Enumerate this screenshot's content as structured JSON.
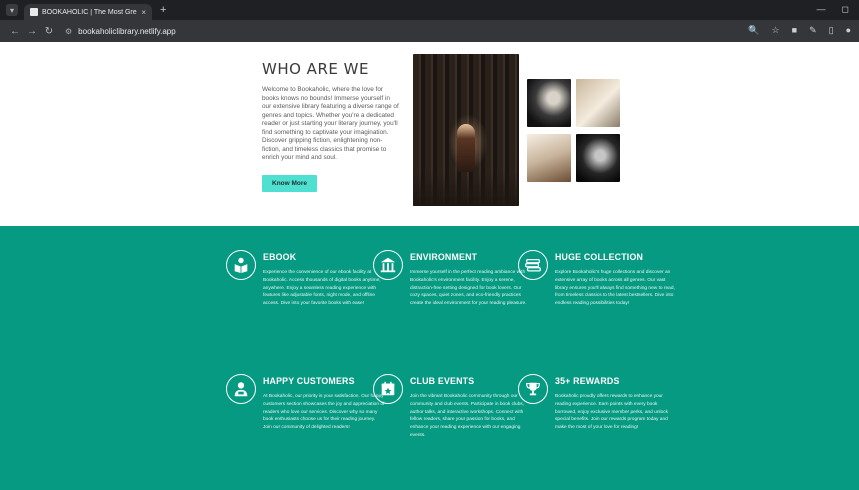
{
  "browser": {
    "tab_title": "BOOKAHOLIC | The Most Grea",
    "tab_close": "×",
    "new_tab": "+",
    "url": "bookaholiclibrary.netlify.app"
  },
  "about": {
    "title": "WHO ARE WE",
    "body": "Welcome to Bookaholic, where the love for books knows no bounds! Immerse yourself in our extensive library featuring a diverse range of genres and topics. Whether you're a dedicated reader or just starting your literary journey, you'll find something to captivate your imagination. Discover gripping fiction, enlightening non-fiction, and timeless classics that promise to enrich your mind and soul.",
    "button": "Know More"
  },
  "features": [
    {
      "title": "EBOOK",
      "icon": "reader-icon",
      "body": "Experience the convenience of our ebook facility at Bookaholic. Access thousands of digital books anytime, anywhere. Enjoy a seamless reading experience with features like adjustable fonts, night mode, and offline access. Dive into your favorite books with ease!"
    },
    {
      "title": "ENVIRONMENT",
      "icon": "building-icon",
      "body": "Immerse yourself in the perfect reading ambiance with Bookaholic's environment facility. Enjoy a serene, distraction-free setting designed for book lovers. Our cozy spaces, quiet zones, and eco-friendly practices create the ideal environment for your reading pleasure."
    },
    {
      "title": "HUGE COLLECTION",
      "icon": "book-stack-icon",
      "body": "Explore Bookaholic's huge collections and discover an extensive array of books across all genres. Our vast library ensures you'll always find something new to read, from timeless classics to the latest bestsellers. Dive into endless reading possibilities today!"
    },
    {
      "title": "HAPPY CUSTOMERS",
      "icon": "customer-icon",
      "body": "At Bookaholic, our priority is your satisfaction. Our happy customers section showcases the joy and appreciation of readers who love our services. Discover why so many book enthusiasts choose us for their reading journey. Join our community of delighted readers!"
    },
    {
      "title": "CLUB EVENTS",
      "icon": "calendar-star-icon",
      "body": "Join the vibrant Bookaholic community through our community and club events. Participate in book clubs, author talks, and interactive workshops. Connect with fellow readers, share your passion for books, and enhance your reading experience with our engaging events."
    },
    {
      "title": "35+ REWARDS",
      "icon": "trophy-icon",
      "body": "Bookaholic proudly offers rewards to enhance your reading experience. Earn points with every book borrowed, enjoy exclusive member perks, and unlock special benefits. Join our rewards program today and make the most of your love for reading!"
    }
  ],
  "colors": {
    "feature_bg": "#079a83",
    "button_bg": "#4fe0d2",
    "chrome_dark": "#1f2023",
    "chrome_bar": "#35363a"
  }
}
